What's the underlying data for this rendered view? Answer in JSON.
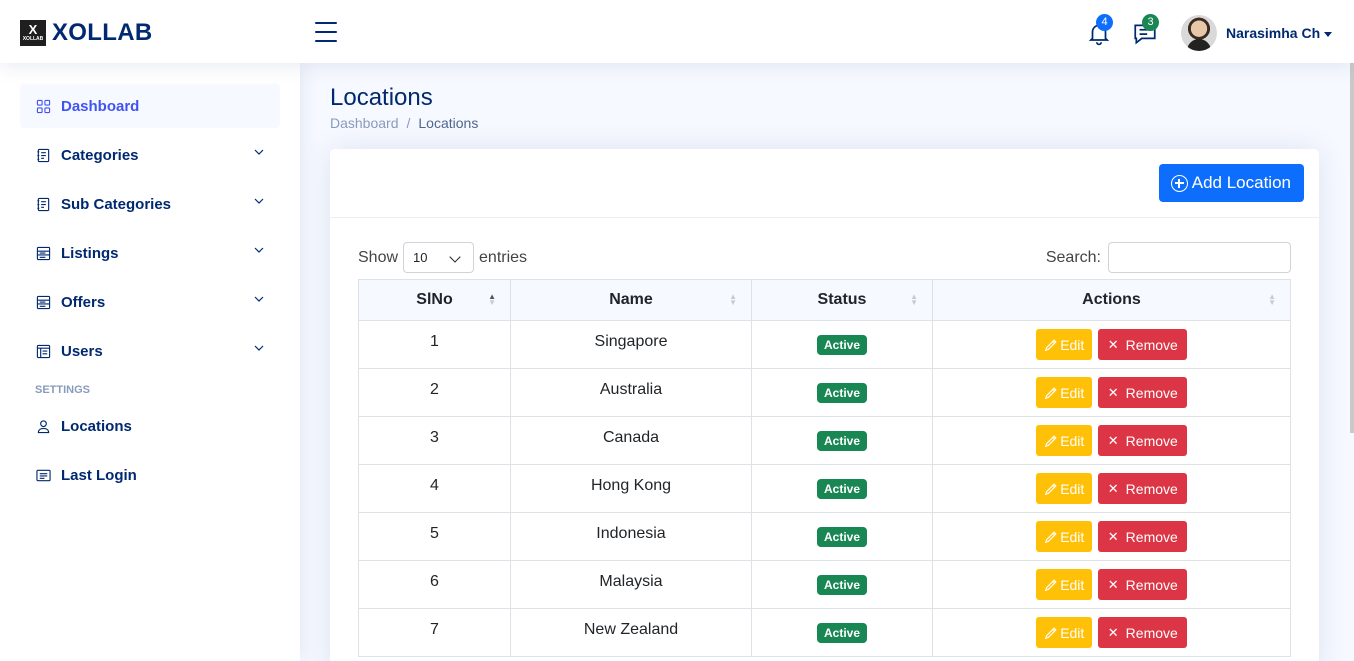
{
  "header": {
    "logo_mark": "X",
    "logo_mark_small": "XOLLAB",
    "logo_text": "XOLLAB",
    "notifications_count": "4",
    "messages_count": "3",
    "user_name": "Narasimha Ch"
  },
  "sidebar": {
    "items": [
      {
        "label": "Dashboard",
        "icon": "grid-icon",
        "active": true
      },
      {
        "label": "Categories",
        "icon": "journal-icon",
        "expandable": true
      },
      {
        "label": "Sub Categories",
        "icon": "journal-icon",
        "expandable": true
      },
      {
        "label": "Listings",
        "icon": "layout-text-icon",
        "expandable": true
      },
      {
        "label": "Offers",
        "icon": "layout-text-icon",
        "expandable": true
      },
      {
        "label": "Users",
        "icon": "layout-window-icon",
        "expandable": true
      }
    ],
    "settings_heading": "SETTINGS",
    "settings_items": [
      {
        "label": "Locations",
        "icon": "person-icon"
      },
      {
        "label": "Last Login",
        "icon": "card-list-icon"
      }
    ]
  },
  "page": {
    "title": "Locations",
    "breadcrumb": [
      "Dashboard",
      "Locations"
    ],
    "add_button": "Add Location"
  },
  "table_controls": {
    "show_label": "Show",
    "entries_value": "10",
    "entries_label": "entries",
    "search_label": "Search:"
  },
  "table": {
    "columns": [
      "SlNo",
      "Name",
      "Status",
      "Actions"
    ],
    "rows": [
      {
        "slno": "1",
        "name": "Singapore",
        "status": "Active"
      },
      {
        "slno": "2",
        "name": "Australia",
        "status": "Active"
      },
      {
        "slno": "3",
        "name": "Canada",
        "status": "Active"
      },
      {
        "slno": "4",
        "name": "Hong Kong",
        "status": "Active"
      },
      {
        "slno": "5",
        "name": "Indonesia",
        "status": "Active"
      },
      {
        "slno": "6",
        "name": "Malaysia",
        "status": "Active"
      },
      {
        "slno": "7",
        "name": "New Zealand",
        "status": "Active"
      }
    ],
    "edit_label": "Edit",
    "remove_label": "Remove"
  },
  "colors": {
    "primary": "#0d6efd",
    "status_active": "#198754",
    "edit": "#ffc107",
    "remove": "#dc3545",
    "nav_text": "#012970",
    "nav_active": "#4154f1"
  }
}
